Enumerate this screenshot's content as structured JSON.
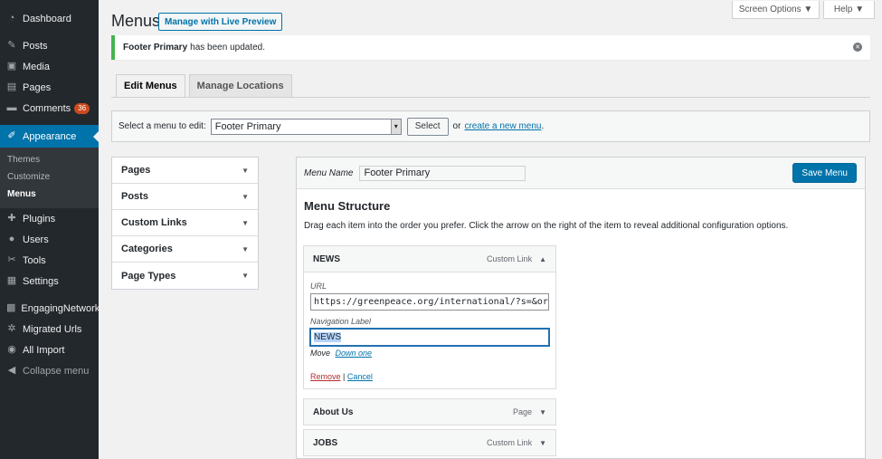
{
  "sidebar": {
    "items": [
      {
        "label": "Dashboard",
        "icon": "dashboard-icon",
        "glyph": "◔"
      },
      {
        "label": "Posts",
        "icon": "pin-icon",
        "glyph": "✎"
      },
      {
        "label": "Media",
        "icon": "media-icon",
        "glyph": "▣"
      },
      {
        "label": "Pages",
        "icon": "pages-icon",
        "glyph": "▤"
      },
      {
        "label": "Comments",
        "icon": "comments-icon",
        "glyph": "▬",
        "badge": "36"
      },
      {
        "label": "Appearance",
        "icon": "paintbrush-icon",
        "glyph": "✐"
      },
      {
        "label": "Plugins",
        "icon": "plugins-icon",
        "glyph": "✚"
      },
      {
        "label": "Users",
        "icon": "users-icon",
        "glyph": "●"
      },
      {
        "label": "Tools",
        "icon": "tools-icon",
        "glyph": "✂"
      },
      {
        "label": "Settings",
        "icon": "settings-icon",
        "glyph": "▦"
      },
      {
        "label": "EngagingNetworks",
        "icon": "engaging-networks-icon",
        "glyph": "▩"
      },
      {
        "label": "Migrated Urls",
        "icon": "gear-icon",
        "glyph": "✲"
      },
      {
        "label": "All Import",
        "icon": "all-import-icon",
        "glyph": "◉"
      },
      {
        "label": "Collapse menu",
        "icon": "collapse-icon",
        "glyph": "◀"
      }
    ],
    "submenu": [
      "Themes",
      "Customize",
      "Menus"
    ],
    "colors": {
      "bg": "#23282d",
      "active": "#0073aa"
    }
  },
  "header": {
    "title": "Menus",
    "live_preview": "Manage with Live Preview",
    "screen_options": "Screen Options ▼",
    "help": "Help ▼"
  },
  "notice": {
    "menu_name": "Footer Primary",
    "message": "has been updated."
  },
  "tabs": [
    "Edit Menus",
    "Manage Locations"
  ],
  "select_bar": {
    "label": "Select a menu to edit:",
    "selected": "Footer Primary",
    "button": "Select",
    "or": "or",
    "create_link": "create a new menu",
    "period": "."
  },
  "accordion": [
    "Pages",
    "Posts",
    "Custom Links",
    "Categories",
    "Page Types"
  ],
  "menu": {
    "name_label": "Menu Name",
    "name_value": "Footer Primary",
    "save_button": "Save Menu",
    "structure_title": "Menu Structure",
    "structure_desc": "Drag each item into the order you prefer. Click the arrow on the right of the item to reveal additional configuration options.",
    "items": [
      {
        "title": "NEWS",
        "type": "Custom Link",
        "expanded": true
      },
      {
        "title": "About Us",
        "type": "Page",
        "expanded": false
      },
      {
        "title": "JOBS",
        "type": "Custom Link",
        "expanded": false
      }
    ],
    "expanded": {
      "url_label": "URL",
      "url_value": "https://greenpeace.org/international/?s=&orde",
      "nav_label": "Navigation Label",
      "nav_value": "NEWS",
      "move_label": "Move",
      "move_link": "Down one",
      "remove": "Remove",
      "separator": "|",
      "cancel": "Cancel"
    }
  }
}
